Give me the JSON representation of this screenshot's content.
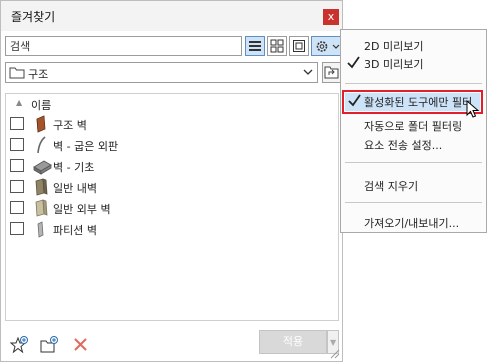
{
  "panel": {
    "title": "즐겨찾기",
    "close_label": "x",
    "search_placeholder": "검색",
    "folder_name": "구조",
    "column_header": "이름",
    "items": [
      {
        "label": "구조 벽",
        "icon": "brick-wall-icon"
      },
      {
        "label": "벽 - 굽은 외판",
        "icon": "curved-wall-icon"
      },
      {
        "label": "벽 - 기초",
        "icon": "foundation-wall-icon"
      },
      {
        "label": "일반 내벽",
        "icon": "interior-wall-icon"
      },
      {
        "label": "일반 외부 벽",
        "icon": "exterior-wall-icon"
      },
      {
        "label": "파티션 벽",
        "icon": "partition-wall-icon"
      }
    ],
    "apply_label": "적용"
  },
  "menu": {
    "items": [
      {
        "label": "2D 미리보기",
        "checked": false
      },
      {
        "label": "3D 미리보기",
        "checked": true
      },
      {
        "label": "활성화된 도구에만 필터",
        "checked": true,
        "highlighted": true
      },
      {
        "label": "자동으로 폴더 필터링",
        "checked": false
      },
      {
        "label": "요소 전송 설정...",
        "checked": false
      },
      {
        "label": "검색 지우기",
        "checked": false
      },
      {
        "label": "가져오기/내보내기...",
        "checked": false
      }
    ]
  },
  "colors": {
    "highlight_border": "#e0202a",
    "highlight_fill": "#cde3f8",
    "close_button": "#c9332d",
    "active_view_button": "#cfe3f7"
  }
}
